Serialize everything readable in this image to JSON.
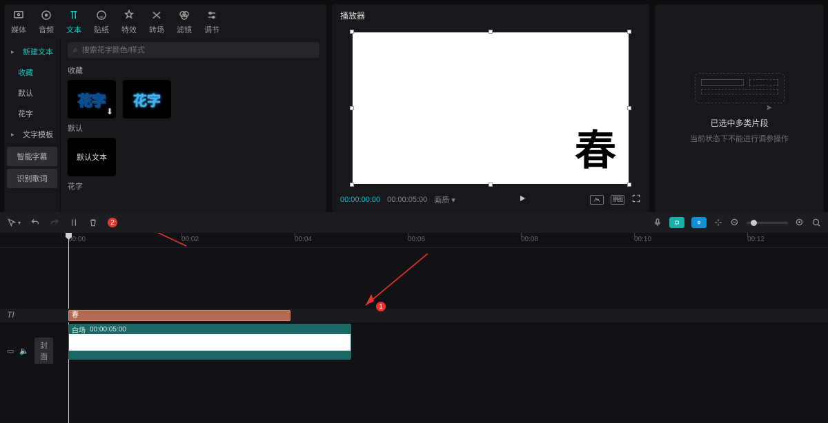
{
  "tabs": [
    {
      "label": "媒体"
    },
    {
      "label": "音频"
    },
    {
      "label": "文本"
    },
    {
      "label": "贴纸"
    },
    {
      "label": "特效"
    },
    {
      "label": "转场"
    },
    {
      "label": "滤镜"
    },
    {
      "label": "调节"
    }
  ],
  "side": {
    "new_text": "新建文本",
    "favorites": "收藏",
    "default": "默认",
    "huazi": "花字",
    "template": "文字模板",
    "smart": "智能字幕",
    "lyrics": "识别歌词"
  },
  "search": {
    "placeholder": "搜索花字颜色/样式"
  },
  "sections": {
    "fav": "收藏",
    "def": "默认",
    "huazi": "花字",
    "huazi_sample": "花字",
    "default_text": "默认文本"
  },
  "player": {
    "title": "播放器",
    "char": "春",
    "tc_cur": "00:00:00:00",
    "tc_dur": "00:00:05:00",
    "ratio": "画质",
    "btn_orig": "原图"
  },
  "props": {
    "title": "已选中多类片段",
    "sub": "当前状态下不能进行调参操作"
  },
  "toolbar": {
    "badge2": "2"
  },
  "ruler": {
    "t0": "00:00",
    "t1": "00:02",
    "t2": "00:04",
    "t3": "00:06",
    "t4": "00:08",
    "t5": "00:10",
    "t6": "00:12"
  },
  "timeline": {
    "text_label": "春",
    "video_name": "白场",
    "video_dur": "00:00:05:00",
    "cover": "封面",
    "tl_T": "TI"
  },
  "annotations": {
    "n1": "1",
    "n2": "2"
  }
}
